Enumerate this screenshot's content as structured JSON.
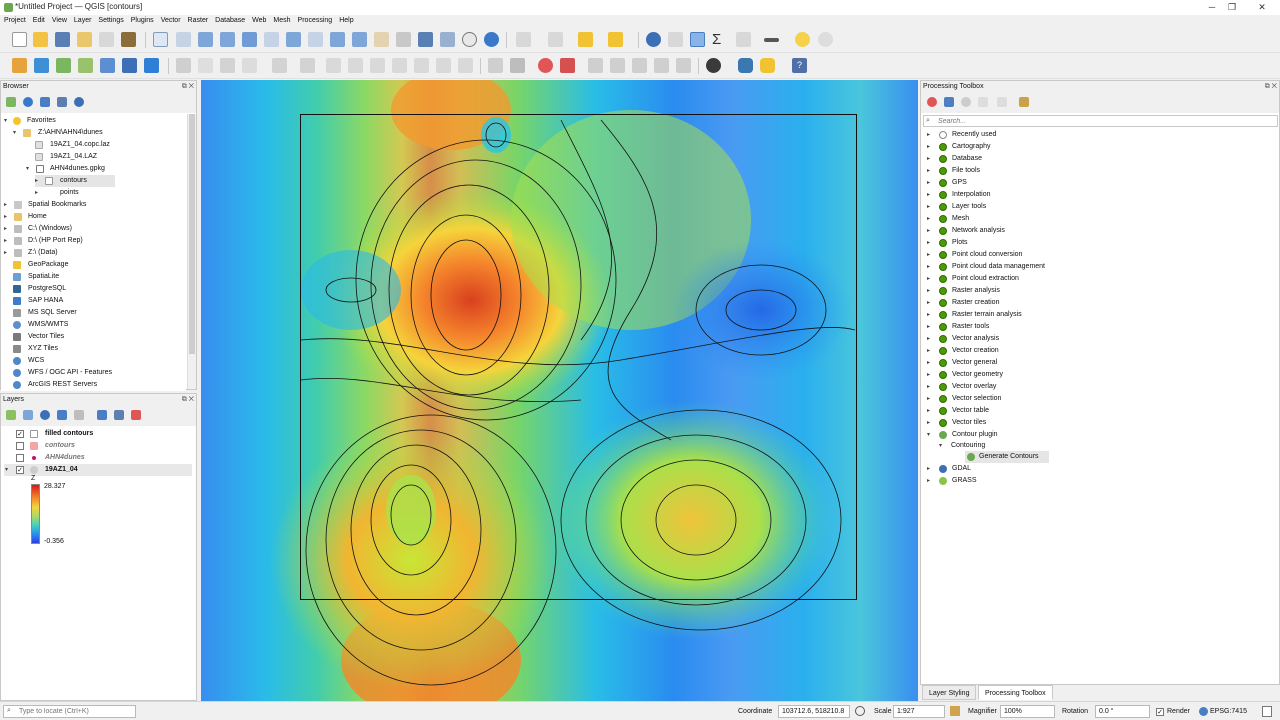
{
  "window": {
    "title": "*Untitled Project — QGIS [contours]"
  },
  "menu": [
    "Project",
    "Edit",
    "View",
    "Layer",
    "Settings",
    "Plugins",
    "Vector",
    "Raster",
    "Database",
    "Web",
    "Mesh",
    "Processing",
    "Help"
  ],
  "browser": {
    "title": "Browser",
    "items": [
      {
        "label": "Favorites"
      },
      {
        "label": "Z:\\AHN\\AHN4\\dunes"
      },
      {
        "label": "19AZ1_04.copc.laz"
      },
      {
        "label": "19AZ1_04.LAZ"
      },
      {
        "label": "AHN4dunes.gpkg"
      },
      {
        "label": "contours"
      },
      {
        "label": "points"
      },
      {
        "label": "Spatial Bookmarks"
      },
      {
        "label": "Home"
      },
      {
        "label": "C:\\ (Windows)"
      },
      {
        "label": "D:\\ (HP Port Rep)"
      },
      {
        "label": "Z:\\ (Data)"
      },
      {
        "label": "GeoPackage"
      },
      {
        "label": "SpatiaLite"
      },
      {
        "label": "PostgreSQL"
      },
      {
        "label": "SAP HANA"
      },
      {
        "label": "MS SQL Server"
      },
      {
        "label": "WMS/WMTS"
      },
      {
        "label": "Vector Tiles"
      },
      {
        "label": "XYZ Tiles"
      },
      {
        "label": "WCS"
      },
      {
        "label": "WFS / OGC API - Features"
      },
      {
        "label": "ArcGIS REST Servers"
      }
    ]
  },
  "layers": {
    "title": "Layers",
    "items": [
      {
        "label": "filled contours",
        "checked": true
      },
      {
        "label": "contours",
        "checked": false
      },
      {
        "label": "AHN4dunes",
        "checked": false
      },
      {
        "label": "19AZ1_04",
        "checked": true
      }
    ],
    "legend": {
      "axis": "Z",
      "max": "28.327",
      "min": "-0.356"
    }
  },
  "toolbox": {
    "title": "Processing Toolbox",
    "search_placeholder": "Search...",
    "items": [
      {
        "label": "Recently used"
      },
      {
        "label": "Cartography"
      },
      {
        "label": "Database"
      },
      {
        "label": "File tools"
      },
      {
        "label": "GPS"
      },
      {
        "label": "Interpolation"
      },
      {
        "label": "Layer tools"
      },
      {
        "label": "Mesh"
      },
      {
        "label": "Network analysis"
      },
      {
        "label": "Plots"
      },
      {
        "label": "Point cloud conversion"
      },
      {
        "label": "Point cloud data management"
      },
      {
        "label": "Point cloud extraction"
      },
      {
        "label": "Raster analysis"
      },
      {
        "label": "Raster creation"
      },
      {
        "label": "Raster terrain analysis"
      },
      {
        "label": "Raster tools"
      },
      {
        "label": "Vector analysis"
      },
      {
        "label": "Vector creation"
      },
      {
        "label": "Vector general"
      },
      {
        "label": "Vector geometry"
      },
      {
        "label": "Vector overlay"
      },
      {
        "label": "Vector selection"
      },
      {
        "label": "Vector table"
      },
      {
        "label": "Vector tiles"
      },
      {
        "label": "Contour plugin"
      },
      {
        "label": "Contouring"
      },
      {
        "label": "Generate Contours"
      },
      {
        "label": "GDAL"
      },
      {
        "label": "GRASS"
      }
    ],
    "tabs": [
      "Layer Styling",
      "Processing Toolbox"
    ]
  },
  "status": {
    "locate_placeholder": "Type to locate (Ctrl+K)",
    "coordinate_label": "Coordinate",
    "coordinate_value": "103712.6, 518210.8",
    "scale_label": "Scale",
    "scale_value": "1:927",
    "magnifier_label": "Magnifier",
    "magnifier_value": "100%",
    "rotation_label": "Rotation",
    "rotation_value": "0.0 °",
    "render_label": "Render",
    "crs": "EPSG:7415"
  },
  "colors": {
    "ramp_top": "#d7191c",
    "ramp_mid": "#a6d96a",
    "ramp_bottom": "#2b3fe0"
  }
}
